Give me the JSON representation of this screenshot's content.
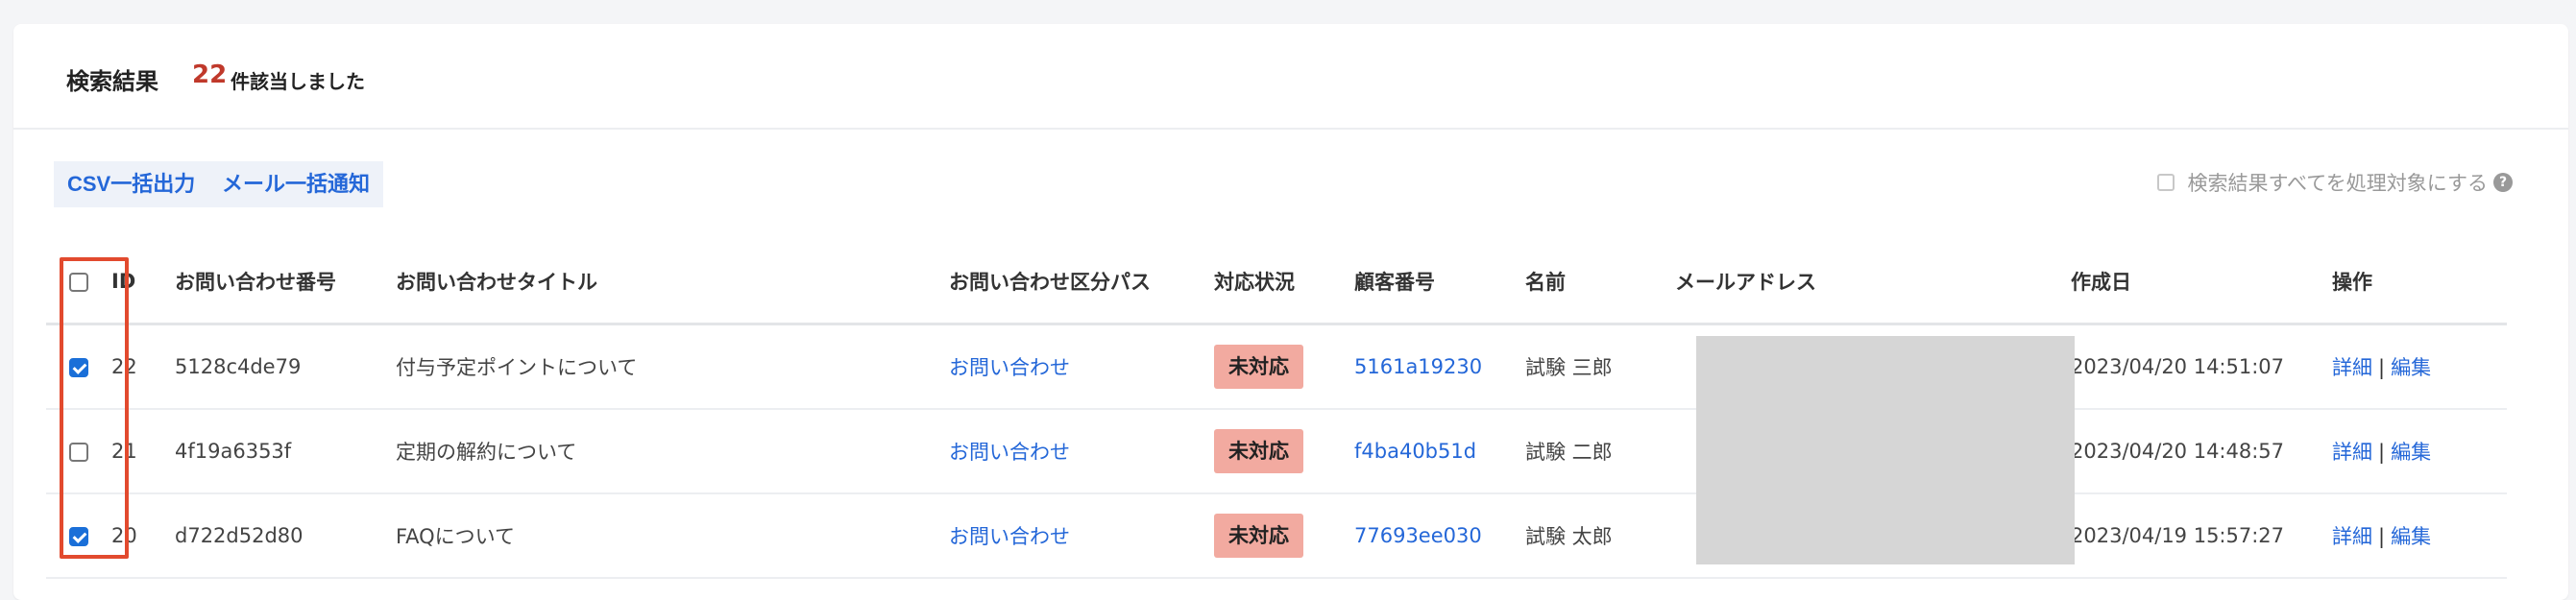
{
  "header": {
    "title": "検索結果",
    "count": "22",
    "suffix": "件該当しました"
  },
  "actions": {
    "csv_label": "CSV一括出力",
    "mail_label": "メール一括通知"
  },
  "all_target_label": "検索結果すべてを処理対象にする",
  "help_icon": "?",
  "table": {
    "headers": {
      "id": "ID",
      "num": "お問い合わせ番号",
      "title": "お問い合わせタイトル",
      "path": "お問い合わせ区分パス",
      "status": "対応状況",
      "cust": "顧客番号",
      "name": "名前",
      "mail": "メールアドレス",
      "date": "作成日",
      "ops": "操作"
    },
    "rows": [
      {
        "checked": true,
        "id": "22",
        "num": "5128c4de79",
        "title": "付与予定ポイントについて",
        "path": "お問い合わせ",
        "status": "未対応",
        "cust": "5161a19230",
        "name": "試験 三郎",
        "date": "2023/04/20 14:51:07",
        "detail": "詳細",
        "sep": "|",
        "edit": "編集"
      },
      {
        "checked": false,
        "id": "21",
        "num": "4f19a6353f",
        "title": "定期の解約について",
        "path": "お問い合わせ",
        "status": "未対応",
        "cust": "f4ba40b51d",
        "name": "試験 二郎",
        "date": "2023/04/20 14:48:57",
        "detail": "詳細",
        "sep": "|",
        "edit": "編集"
      },
      {
        "checked": true,
        "id": "20",
        "num": "d722d52d80",
        "title": "FAQについて",
        "path": "お問い合わせ",
        "status": "未対応",
        "cust": "77693ee030",
        "name": "試験 太郎",
        "date": "2023/04/19 15:57:27",
        "detail": "詳細",
        "sep": "|",
        "edit": "編集"
      }
    ]
  },
  "colors": {
    "accent": "#2467d8",
    "count": "#c0392b",
    "badge_bg": "#f2aaa0",
    "highlight": "#e24a2e"
  }
}
